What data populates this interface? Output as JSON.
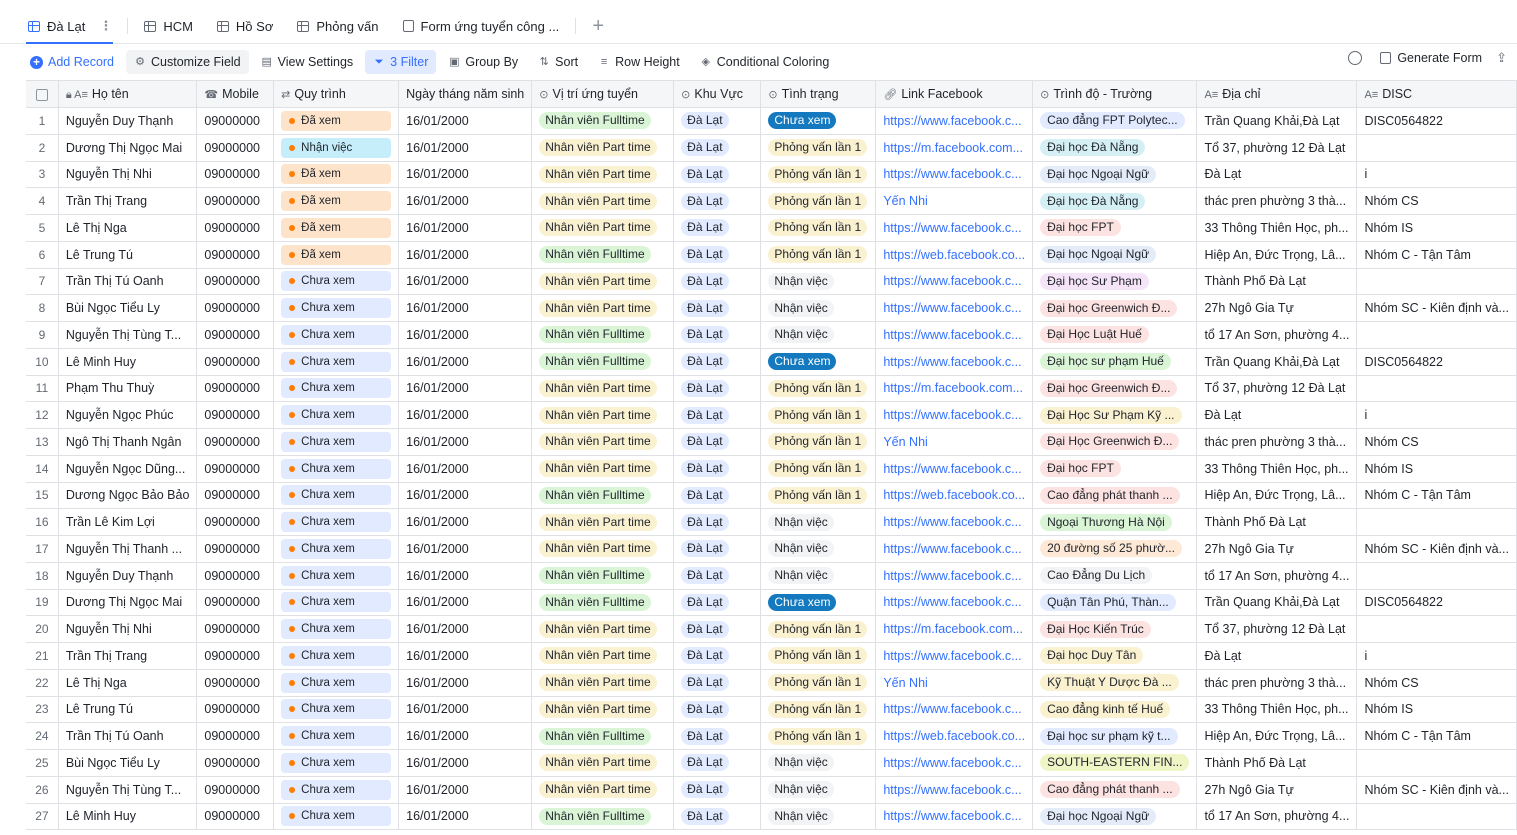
{
  "tabs": [
    {
      "label": "Đà Lạt",
      "icon": "table-icon",
      "active": true
    },
    {
      "label": "HCM",
      "icon": "table-icon"
    },
    {
      "label": "Hồ Sơ",
      "icon": "table-icon"
    },
    {
      "label": "Phỏng vấn",
      "icon": "table-icon"
    },
    {
      "label": "Form ứng tuyển công ...",
      "icon": "form-icon"
    }
  ],
  "toolbar": {
    "add_record": "Add Record",
    "customize_field": "Customize Field",
    "view_settings": "View Settings",
    "filter": "3 Filter",
    "group_by": "Group By",
    "sort": "Sort",
    "row_height": "Row Height",
    "conditional_coloring": "Conditional Coloring",
    "generate_form": "Generate Form"
  },
  "columns": [
    "Họ tên",
    "Mobile",
    "Quy trình",
    "Ngày tháng năm sinh",
    "Vị trí ứng tuyển",
    "Khu Vực",
    "Tình trạng",
    "Link Facebook",
    "Trình độ - Trường",
    "Địa chỉ",
    "DISC"
  ],
  "rows": [
    {
      "n": "1",
      "name": "Nguyễn Duy Thạnh",
      "mobile": "09000000",
      "qt": "Đã xem",
      "dob": "16/01/2000",
      "pos": "Nhân viên Fulltime",
      "kv": "Đà Lạt",
      "tt": "Chưa xem",
      "fb": "https://www.facebook.c...",
      "edu": "Cao đẳng FPT Polytec...",
      "edu_c": "#e1eaff",
      "addr": "Trần Quang Khải,Đà Lạt",
      "disc": "DISC0564822"
    },
    {
      "n": "2",
      "name": "Dương Thị Ngọc Mai",
      "mobile": "09000000",
      "qt": "Nhận việc",
      "dob": "16/01/2000",
      "pos": "Nhân viên Part time",
      "kv": "Đà Lạt",
      "tt": "Phỏng vấn lần 1",
      "fb": "https://m.facebook.com...",
      "edu": "Đại học Đà Nẵng",
      "edu_c": "#d5f0f5",
      "addr": "Tổ 37, phường 12 Đà Lạt",
      "disc": ""
    },
    {
      "n": "3",
      "name": "Nguyễn Thị Nhi",
      "mobile": "09000000",
      "qt": "Đã xem",
      "dob": "16/01/2000",
      "pos": "Nhân viên Part time",
      "kv": "Đà Lạt",
      "tt": "Phỏng vấn lần 1",
      "fb": "https://www.facebook.c...",
      "edu": "Đại học Ngoại Ngữ",
      "edu_c": "#e4ecfa",
      "addr": "Đà Lạt",
      "disc": "i"
    },
    {
      "n": "4",
      "name": "Trần Thị Trang",
      "mobile": "09000000",
      "qt": "Đã xem",
      "dob": "16/01/2000",
      "pos": "Nhân viên Part time",
      "kv": "Đà Lạt",
      "tt": "Phỏng vấn lần 1",
      "fb": "Yến Nhi",
      "edu": "Đại học Đà Nẵng",
      "edu_c": "#d5f0f5",
      "addr": "thác pren phường 3 thà...",
      "disc": "Nhóm CS"
    },
    {
      "n": "5",
      "name": "Lê Thị Nga",
      "mobile": "09000000",
      "qt": "Đã xem",
      "dob": "16/01/2000",
      "pos": "Nhân viên Part time",
      "kv": "Đà Lạt",
      "tt": "Phỏng vấn lần 1",
      "fb": "https://www.facebook.c...",
      "edu": "Đại học FPT",
      "edu_c": "#fde2e2",
      "addr": "33 Thông Thiên Học, ph...",
      "disc": "Nhóm IS"
    },
    {
      "n": "6",
      "name": "Lê Trung Tú",
      "mobile": "09000000",
      "qt": "Đã xem",
      "dob": "16/01/2000",
      "pos": "Nhân viên Fulltime",
      "kv": "Đà Lạt",
      "tt": "Phỏng vấn lần 1",
      "fb": "https://web.facebook.co...",
      "edu": "Đại học Ngoại Ngữ",
      "edu_c": "#e4ecfa",
      "addr": "Hiệp An, Đức Trọng, Lâ...",
      "disc": "Nhóm C - Tận Tâm"
    },
    {
      "n": "7",
      "name": "Trần Thị Tú Oanh",
      "mobile": "09000000",
      "qt": "Chưa xem",
      "dob": "16/01/2000",
      "pos": "Nhân viên Part time",
      "kv": "Đà Lạt",
      "tt": "Nhận việc",
      "fb": "https://www.facebook.c...",
      "edu": "Đại học Sư Phạm",
      "edu_c": "#f5e3f7",
      "addr": "Thành Phố Đà Lạt",
      "disc": ""
    },
    {
      "n": "8",
      "name": "Bùi Ngọc Tiểu Ly",
      "mobile": "09000000",
      "qt": "Chưa xem",
      "dob": "16/01/2000",
      "pos": "Nhân viên Part time",
      "kv": "Đà Lạt",
      "tt": "Nhận việc",
      "fb": "https://www.facebook.c...",
      "edu": "Đại học Greenwich Đ...",
      "edu_c": "#fde2e2",
      "addr": "27h Ngô Gia Tự",
      "disc": "Nhóm SC - Kiên định và..."
    },
    {
      "n": "9",
      "name": "Nguyễn Thị Tùng T...",
      "mobile": "09000000",
      "qt": "Chưa xem",
      "dob": "16/01/2000",
      "pos": "Nhân viên Fulltime",
      "kv": "Đà Lạt",
      "tt": "Nhận việc",
      "fb": "https://www.facebook.c...",
      "edu": "Đại Học Luật Huế",
      "edu_c": "#fde2e2",
      "addr": "tổ 17 An Sơn, phường 4...",
      "disc": ""
    },
    {
      "n": "10",
      "name": "Lê Minh Huy",
      "mobile": "09000000",
      "qt": "Chưa xem",
      "dob": "16/01/2000",
      "pos": "Nhân viên Fulltime",
      "kv": "Đà Lạt",
      "tt": "Chưa xem",
      "fb": "https://www.facebook.c...",
      "edu": "Đại học sư phạm Huế",
      "edu_c": "#d9f5d6",
      "addr": "Trần Quang Khải,Đà Lạt",
      "disc": "DISC0564822"
    },
    {
      "n": "11",
      "name": "Phạm Thu Thuỳ",
      "mobile": "09000000",
      "qt": "Chưa xem",
      "dob": "16/01/2000",
      "pos": "Nhân viên Part time",
      "kv": "Đà Lạt",
      "tt": "Phỏng vấn lần 1",
      "fb": "https://m.facebook.com...",
      "edu": "Đại học Greenwich Đ...",
      "edu_c": "#fde2e2",
      "addr": "Tổ 37, phường 12 Đà Lạt",
      "disc": ""
    },
    {
      "n": "12",
      "name": "Nguyễn Ngọc Phúc",
      "mobile": "09000000",
      "qt": "Chưa xem",
      "dob": "16/01/2000",
      "pos": "Nhân viên Part time",
      "kv": "Đà Lạt",
      "tt": "Phỏng vấn lần 1",
      "fb": "https://www.facebook.c...",
      "edu": "Đại Học Sư Phạm Kỹ ...",
      "edu_c": "#faf1d1",
      "addr": "Đà Lạt",
      "disc": "i"
    },
    {
      "n": "13",
      "name": "Ngô Thị Thanh Ngân",
      "mobile": "09000000",
      "qt": "Chưa xem",
      "dob": "16/01/2000",
      "pos": "Nhân viên Part time",
      "kv": "Đà Lạt",
      "tt": "Phỏng vấn lần 1",
      "fb": "Yến Nhi",
      "edu": "Đại Học Greenwich Đ...",
      "edu_c": "#fde2e2",
      "addr": "thác pren phường 3 thà...",
      "disc": "Nhóm CS"
    },
    {
      "n": "14",
      "name": "Nguyễn Ngọc Dũng...",
      "mobile": "09000000",
      "qt": "Chưa xem",
      "dob": "16/01/2000",
      "pos": "Nhân viên Part time",
      "kv": "Đà Lạt",
      "tt": "Phỏng vấn lần 1",
      "fb": "https://www.facebook.c...",
      "edu": "Đại học FPT",
      "edu_c": "#fde2e2",
      "addr": "33 Thông Thiên Học, ph...",
      "disc": "Nhóm IS"
    },
    {
      "n": "15",
      "name": "Dương Ngọc Bảo Bảo",
      "mobile": "09000000",
      "qt": "Chưa xem",
      "dob": "16/01/2000",
      "pos": "Nhân viên Fulltime",
      "kv": "Đà Lạt",
      "tt": "Phỏng vấn lần 1",
      "fb": "https://web.facebook.co...",
      "edu": "Cao đẳng phát thanh ...",
      "edu_c": "#fde2e2",
      "addr": "Hiệp An, Đức Trọng, Lâ...",
      "disc": "Nhóm C - Tận Tâm"
    },
    {
      "n": "16",
      "name": "Trần Lê Kim Lợi",
      "mobile": "09000000",
      "qt": "Chưa xem",
      "dob": "16/01/2000",
      "pos": "Nhân viên Part time",
      "kv": "Đà Lạt",
      "tt": "Nhận việc",
      "fb": "https://www.facebook.c...",
      "edu": "Ngoại Thương Hà Nội",
      "edu_c": "#d9f5d6",
      "addr": "Thành Phố Đà Lạt",
      "disc": ""
    },
    {
      "n": "17",
      "name": "Nguyễn Thị Thanh ...",
      "mobile": "09000000",
      "qt": "Chưa xem",
      "dob": "16/01/2000",
      "pos": "Nhân viên Part time",
      "kv": "Đà Lạt",
      "tt": "Nhận việc",
      "fb": "https://www.facebook.c...",
      "edu": "20 đường số 25 phườ...",
      "edu_c": "#fde9d6",
      "addr": "27h Ngô Gia Tự",
      "disc": "Nhóm SC - Kiên định và..."
    },
    {
      "n": "18",
      "name": "Nguyễn Duy Thạnh",
      "mobile": "09000000",
      "qt": "Chưa xem",
      "dob": "16/01/2000",
      "pos": "Nhân viên Fulltime",
      "kv": "Đà Lạt",
      "tt": "Nhận việc",
      "fb": "https://www.facebook.c...",
      "edu": "Cao Đẳng Du Lịch",
      "edu_c": "#f2f3f5",
      "addr": "tổ 17 An Sơn, phường 4...",
      "disc": ""
    },
    {
      "n": "19",
      "name": "Dương Thị Ngọc Mai",
      "mobile": "09000000",
      "qt": "Chưa xem",
      "dob": "16/01/2000",
      "pos": "Nhân viên Fulltime",
      "kv": "Đà Lạt",
      "tt": "Chưa xem",
      "fb": "https://www.facebook.c...",
      "edu": "Quận Tân Phú, Thàn...",
      "edu_c": "#e1eaff",
      "addr": "Trần Quang Khải,Đà Lạt",
      "disc": "DISC0564822"
    },
    {
      "n": "20",
      "name": "Nguyễn Thị Nhi",
      "mobile": "09000000",
      "qt": "Chưa xem",
      "dob": "16/01/2000",
      "pos": "Nhân viên Part time",
      "kv": "Đà Lạt",
      "tt": "Phỏng vấn lần 1",
      "fb": "https://m.facebook.com...",
      "edu": "Đại Học Kiến Trúc",
      "edu_c": "#fde2e2",
      "addr": "Tổ 37, phường 12 Đà Lạt",
      "disc": ""
    },
    {
      "n": "21",
      "name": "Trần Thị Trang",
      "mobile": "09000000",
      "qt": "Chưa xem",
      "dob": "16/01/2000",
      "pos": "Nhân viên Part time",
      "kv": "Đà Lạt",
      "tt": "Phỏng vấn lần 1",
      "fb": "https://www.facebook.c...",
      "edu": "Đại học Duy Tân",
      "edu_c": "#faf1d1",
      "addr": "Đà Lạt",
      "disc": "i"
    },
    {
      "n": "22",
      "name": "Lê Thị Nga",
      "mobile": "09000000",
      "qt": "Chưa xem",
      "dob": "16/01/2000",
      "pos": "Nhân viên Part time",
      "kv": "Đà Lạt",
      "tt": "Phỏng vấn lần 1",
      "fb": "Yến Nhi",
      "edu": "Kỹ Thuật Y Dược Đà ...",
      "edu_c": "#faf1d1",
      "addr": "thác pren phường 3 thà...",
      "disc": "Nhóm CS"
    },
    {
      "n": "23",
      "name": "Lê Trung Tú",
      "mobile": "09000000",
      "qt": "Chưa xem",
      "dob": "16/01/2000",
      "pos": "Nhân viên Part time",
      "kv": "Đà Lạt",
      "tt": "Phỏng vấn lần 1",
      "fb": "https://www.facebook.c...",
      "edu": "Cao đẳng kinh tế Huế",
      "edu_c": "#faf1d1",
      "addr": "33 Thông Thiên Học, ph...",
      "disc": "Nhóm IS"
    },
    {
      "n": "24",
      "name": "Trần Thị Tú Oanh",
      "mobile": "09000000",
      "qt": "Chưa xem",
      "dob": "16/01/2000",
      "pos": "Nhân viên Fulltime",
      "kv": "Đà Lạt",
      "tt": "Phỏng vấn lần 1",
      "fb": "https://web.facebook.co...",
      "edu": "Đại học sư phạm kỹ t...",
      "edu_c": "#e1eaff",
      "addr": "Hiệp An, Đức Trọng, Lâ...",
      "disc": "Nhóm C - Tận Tâm"
    },
    {
      "n": "25",
      "name": "Bùi Ngọc Tiểu Ly",
      "mobile": "09000000",
      "qt": "Chưa xem",
      "dob": "16/01/2000",
      "pos": "Nhân viên Part time",
      "kv": "Đà Lạt",
      "tt": "Nhận việc",
      "fb": "https://www.facebook.c...",
      "edu": "SOUTH-EASTERN FIN...",
      "edu_c": "#f0f5c6",
      "addr": "Thành Phố Đà Lạt",
      "disc": ""
    },
    {
      "n": "26",
      "name": "Nguyễn Thị Tùng T...",
      "mobile": "09000000",
      "qt": "Chưa xem",
      "dob": "16/01/2000",
      "pos": "Nhân viên Part time",
      "kv": "Đà Lạt",
      "tt": "Nhận việc",
      "fb": "https://www.facebook.c...",
      "edu": "Cao đẳng phát thanh ...",
      "edu_c": "#fde2e2",
      "addr": "27h Ngô Gia Tự",
      "disc": "Nhóm SC - Kiên định và..."
    },
    {
      "n": "27",
      "name": "Lê Minh Huy",
      "mobile": "09000000",
      "qt": "Chưa xem",
      "dob": "16/01/2000",
      "pos": "Nhân viên Fulltime",
      "kv": "Đà Lạt",
      "tt": "Nhận việc",
      "fb": "https://www.facebook.c...",
      "edu": "Đại học Ngoại Ngữ",
      "edu_c": "#e4ecfa",
      "addr": "tổ 17 An Sơn, phường 4...",
      "disc": ""
    }
  ]
}
